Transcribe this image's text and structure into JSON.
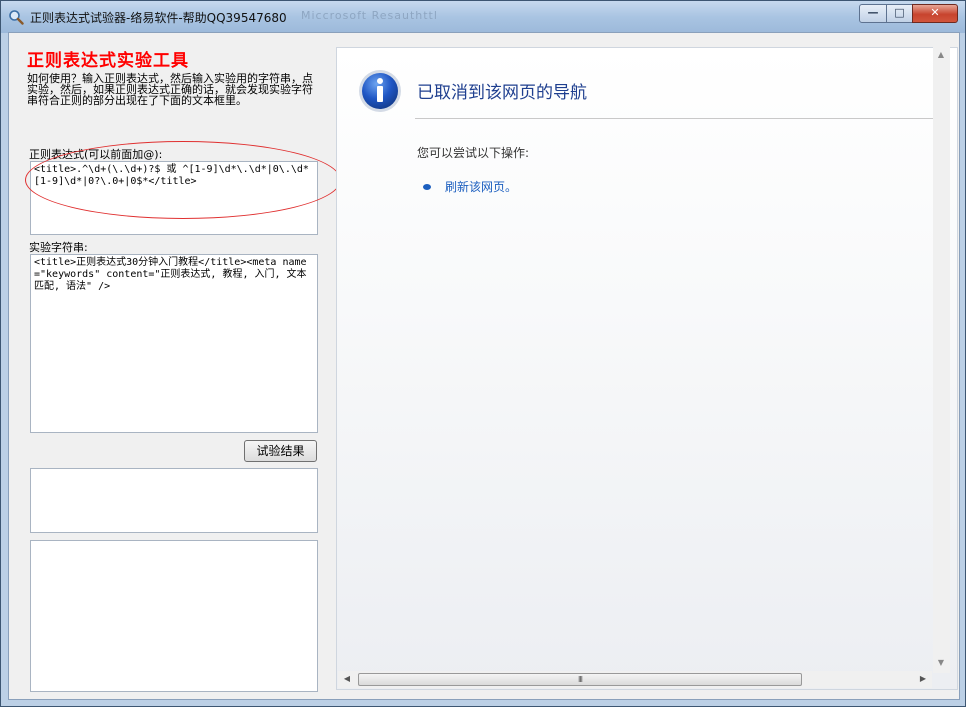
{
  "window": {
    "title": "正则表达式试验器-络易软件-帮助QQ39547680",
    "ghost_title": "Miccrosoft Resauthttl",
    "controls": {
      "minimize": "—",
      "maximize": "□",
      "close": "✕"
    }
  },
  "left": {
    "heading": "正则表达式实验工具",
    "help": "如何使用？输入正则表达式，然后输入实验用的字符串，点实验，然后，如果正则表达式正确的话，就会发现实验字符串符合正则的部分出现在了下面的文本框里。",
    "regex_label": "正则表达式(可以前面加@):",
    "regex_value": "<title>.^\\d+(\\.\\d+)?$ 或 ^[1-9]\\d*\\.\\d*|0\\.\\d*[1-9]\\d*|0?\\.0+|0$*</title>",
    "test_label": "实验字符串:",
    "test_value": "<title>正则表达式30分钟入门教程</title><meta name=\"keywords\" content=\"正则表达式, 教程, 入门, 文本匹配, 语法\" />",
    "button": "试验结果",
    "result_value": "",
    "result2_value": ""
  },
  "browser": {
    "title": "已取消到该网页的导航",
    "try_text": "您可以尝试以下操作:",
    "refresh_link": "刷新该网页。",
    "info_icon": "info-icon",
    "scroll_thumb": "III"
  },
  "colors": {
    "heading": "#ff0000",
    "link": "#1c5fbf",
    "nav_title": "#1f3f8f",
    "annotation": "#e03030"
  }
}
